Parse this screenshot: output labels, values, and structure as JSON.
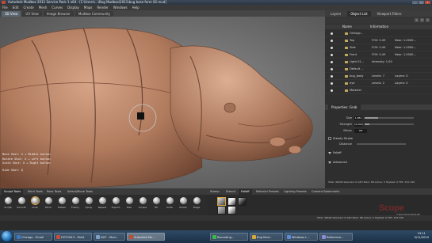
{
  "window": {
    "title": "Autodesk Mudbox 2011 Service Pack 1 x64 - [C:\\Users\\...\\Bug Mudbox\\2011\\bug base form 02.mud]"
  },
  "window_controls": {
    "minimize": "_",
    "maximize": "□",
    "close": "x"
  },
  "menu": [
    "File",
    "Edit",
    "Create",
    "Mesh",
    "Curves",
    "Display",
    "Maps",
    "Render",
    "Windows",
    "Help"
  ],
  "view_tabs": [
    {
      "label": "3D View",
      "active": true
    },
    {
      "label": "UV View",
      "active": false
    },
    {
      "label": "Image Browser",
      "active": false
    },
    {
      "label": "Mudbox Community",
      "active": false
    }
  ],
  "hud": {
    "lines": [
      "Move Shot: X + Middle button",
      "Rotate Shot: X + Left button",
      "Scale Shot: X + Right button"
    ],
    "hint": "Hide Shot: Q"
  },
  "side_tabs": [
    {
      "label": "Layers",
      "active": false
    },
    {
      "label": "Object List",
      "active": true
    },
    {
      "label": "Viewport Filters",
      "active": false
    }
  ],
  "object_list": {
    "col_name": "Name",
    "col_info": "Information",
    "rows": [
      {
        "name": "Orthogr...",
        "i1": "",
        "i2": ""
      },
      {
        "name": "Top",
        "i1": "FOV: 0.49",
        "i2": "Near: 1.0000..."
      },
      {
        "name": "Side",
        "i1": "FOV: 0.49",
        "i2": "Near: 1.0000..."
      },
      {
        "name": "Front",
        "i1": "FOV: 0.49",
        "i2": "Near: 1.0000..."
      },
      {
        "name": "Light 01...",
        "i1": "Intensity: 1.00",
        "i2": ""
      },
      {
        "name": "Default ...",
        "i1": "",
        "i2": ""
      },
      {
        "name": "bug_body",
        "i1": "Levels: 7",
        "i2": "Layers: 0"
      },
      {
        "name": "eye",
        "i1": "Levels: 2",
        "i2": "Layers: 0"
      },
      {
        "name": "Material",
        "i1": "",
        "i2": ""
      }
    ]
  },
  "properties": {
    "tab": "Properties: Grab",
    "size_label": "Size",
    "size_value": "1.881",
    "size_level": 0.28,
    "strength_label": "Strength",
    "strength_value": "10.000",
    "strength_level": 0.1,
    "mirror_label": "Mirror",
    "mirror_value": "Off",
    "steady_stroke": "Steady Stroke",
    "distance_label": "Distance",
    "falloff": "Falloff",
    "advanced": "Advanced",
    "stats": "Total: 48449  Selected: 0  GPU Mem: 88  Active: 0  Highest: 0  FPS: 152.349"
  },
  "tray_tabs": [
    {
      "label": "Sculpt Tools",
      "active": true
    },
    {
      "label": "Paint Tools",
      "active": false
    },
    {
      "label": "Pose Tools",
      "active": false
    },
    {
      "label": "Select/Move Tools",
      "active": false
    },
    {
      "label": "Stamp",
      "active": false
    },
    {
      "label": "Stencil",
      "active": false
    },
    {
      "label": "Falloff",
      "active": true
    },
    {
      "label": "Material Presets",
      "active": false
    },
    {
      "label": "Lighting Presets",
      "active": false
    },
    {
      "label": "Camera Bookmarks",
      "active": false
    }
  ],
  "sculpt_tools": [
    {
      "label": "Sculpt",
      "active": false
    },
    {
      "label": "Smooth",
      "active": false
    },
    {
      "label": "Grab",
      "active": true
    },
    {
      "label": "Pinch",
      "active": false
    },
    {
      "label": "Flatten",
      "active": false
    },
    {
      "label": "Foamy",
      "active": false
    },
    {
      "label": "Spray",
      "active": false
    },
    {
      "label": "Repeat",
      "active": false
    },
    {
      "label": "Imprint",
      "active": false
    },
    {
      "label": "Wax",
      "active": false
    },
    {
      "label": "Scrape",
      "active": false
    },
    {
      "label": "Fill",
      "active": false
    },
    {
      "label": "Knife",
      "active": false
    },
    {
      "label": "Smear",
      "active": false
    },
    {
      "label": "Bulge",
      "active": false
    }
  ],
  "status": {
    "message": "Total: 48449   Selected: 0   GPU Mem: 88   Active: 0   Highest: 0   FPS: 152.349"
  },
  "watermark": {
    "text": "Scope",
    "sub": "© 3DCLASS WORKSHOP"
  },
  "taskbar": {
    "items": [
      {
        "label": "Chicago - Email",
        "color": "#3a78c8",
        "active": false
      },
      {
        "label": "HOT2043 - Paint",
        "color": "#c84a3a",
        "active": false
      },
      {
        "label": "ADT - Mud...",
        "color": "#7aa0c8",
        "active": false
      },
      {
        "label": "Autodesk Mu...",
        "color": "#c34a2c",
        "active": true
      },
      {
        "label": "Recording...",
        "color": "#3ab84a",
        "active": false
      },
      {
        "label": "Bug Mud...",
        "color": "#d8a83a",
        "active": false
      },
      {
        "label": "Windows L...",
        "color": "#5a8ad8",
        "active": false
      },
      {
        "label": "Reference...",
        "color": "#8a8ad8",
        "active": false
      }
    ],
    "clock_time": "19:11",
    "clock_date": "5/11/2010"
  },
  "colors": {
    "clay": "#b27c60",
    "accent": "#d7a13a",
    "selection": "#4f5864"
  }
}
